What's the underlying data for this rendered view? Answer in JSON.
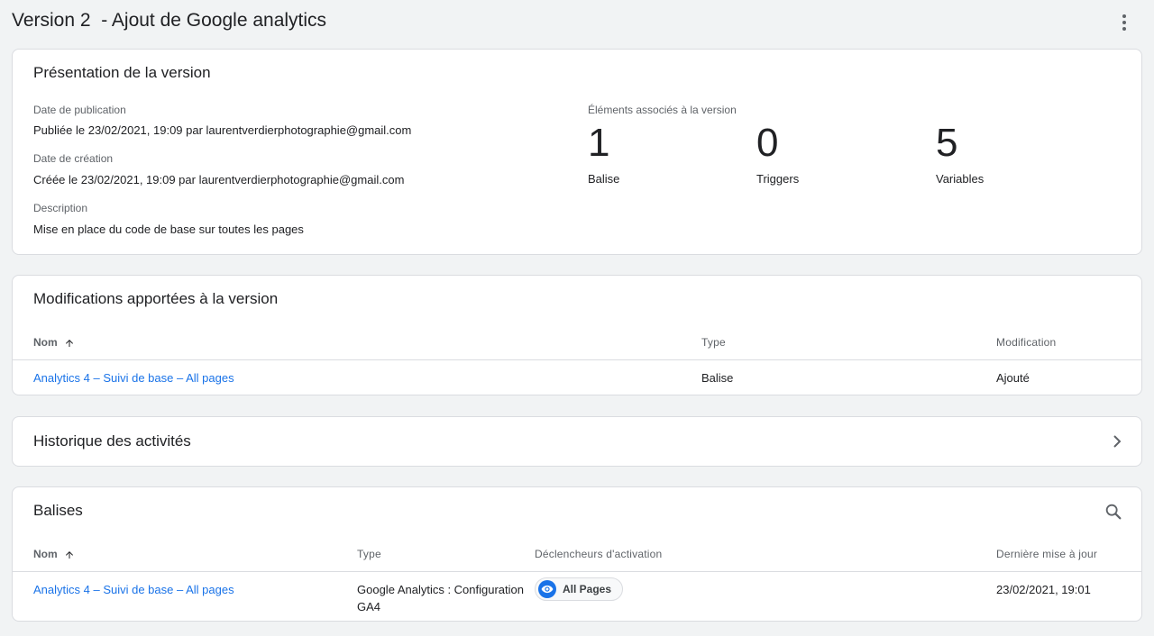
{
  "header": {
    "title": "Version 2  - Ajout de Google analytics",
    "menu_icon": "more-vert-icon"
  },
  "overview": {
    "title": "Présentation de la version",
    "publication_label": "Date de publication",
    "publication_value": "Publiée le 23/02/2021, 19:09 par laurentverdierphotographie@gmail.com",
    "creation_label": "Date de création",
    "creation_value": "Créée le 23/02/2021, 19:09 par laurentverdierphotographie@gmail.com",
    "description_label": "Description",
    "description_value": "Mise en place du code de base sur toutes les pages",
    "elements_label": "Éléments associés à la version",
    "counts": [
      {
        "value": "1",
        "label": "Balise"
      },
      {
        "value": "0",
        "label": "Triggers"
      },
      {
        "value": "5",
        "label": "Variables"
      }
    ]
  },
  "changes": {
    "title": "Modifications apportées à la version",
    "columns": {
      "name": "Nom",
      "type": "Type",
      "modification": "Modification"
    },
    "rows": [
      {
        "name": "Analytics 4 – Suivi de base – All pages",
        "type": "Balise",
        "modification": "Ajouté"
      }
    ]
  },
  "history": {
    "title": "Historique des activités",
    "icon": "chevron-right-icon"
  },
  "tags": {
    "title": "Balises",
    "search_icon": "search-icon",
    "columns": {
      "name": "Nom",
      "type": "Type",
      "triggers": "Déclencheurs d'activation",
      "updated": "Dernière mise à jour"
    },
    "rows": [
      {
        "name": "Analytics 4 – Suivi de base – All pages",
        "type_line1": "Google Analytics : Configuration",
        "type_line2": "GA4",
        "trigger": "All Pages",
        "trigger_icon": "eye-icon",
        "updated": "23/02/2021, 19:01"
      }
    ]
  },
  "colors": {
    "link": "#1a73e8",
    "background": "#f1f3f4",
    "card": "#ffffff",
    "border": "#dadce0"
  }
}
